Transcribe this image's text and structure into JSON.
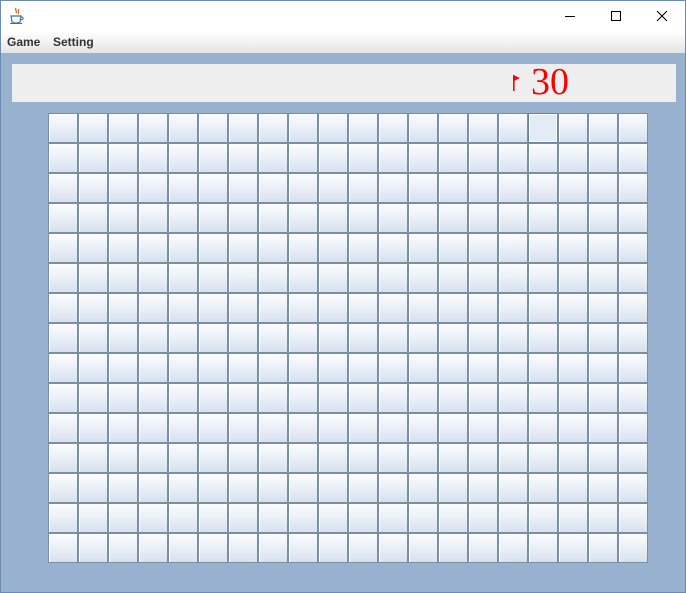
{
  "window": {
    "icon": "java-coffee-cup-icon",
    "controls": [
      "minimize-icon",
      "maximize-icon",
      "close-icon"
    ]
  },
  "menu": {
    "items": [
      {
        "label": "Game"
      },
      {
        "label": "Setting"
      }
    ]
  },
  "status": {
    "flag_icon": "flag-icon",
    "flag_count": "30",
    "accent_color": "#ff0000"
  },
  "board": {
    "rows": 15,
    "columns": 20,
    "state": "all cells unrevealed",
    "highlighted_cell": {
      "row": 1,
      "column": 17
    }
  },
  "colors": {
    "background": "#97b1cf",
    "status_panel": "#eeeeee"
  }
}
